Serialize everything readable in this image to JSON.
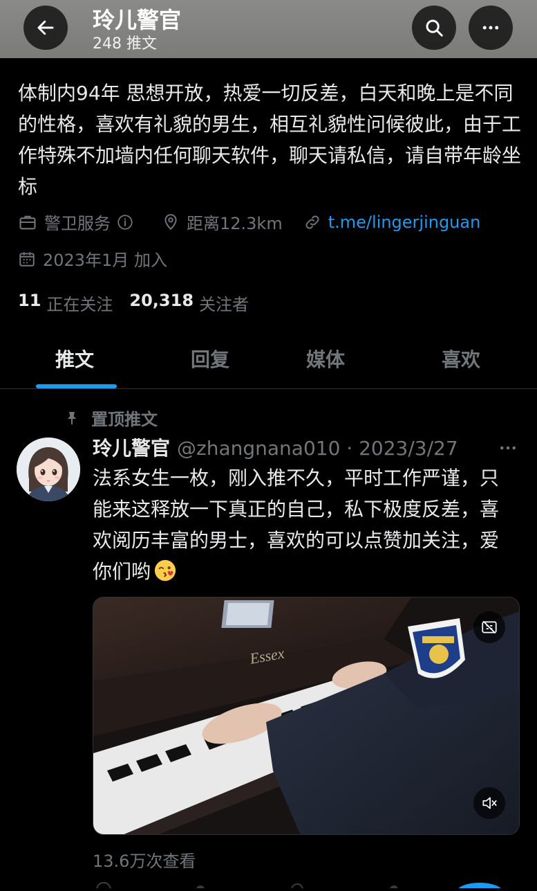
{
  "header": {
    "title": "玲儿警官",
    "subtitle": "248 推文",
    "back_icon": "arrow-left-icon",
    "search_icon": "search-icon",
    "more_icon": "more-horizontal-icon"
  },
  "profile": {
    "bio": "体制内94年 思想开放，热爱一切反差，白天和晚上是不同的性格，喜欢有礼貌的男生，相互礼貌性问候彼此，由于工作特殊不加墙内任何聊天软件，聊天请私信，请自带年龄坐标",
    "category": "警卫服务",
    "distance": "距离12.3km",
    "link": "t.me/lingerjinguan",
    "joined": "2023年1月 加入",
    "following_count": "11",
    "following_label": "正在关注",
    "followers_count": "20,318",
    "followers_label": "关注者"
  },
  "tabs": [
    {
      "label": "推文",
      "active": true
    },
    {
      "label": "回复",
      "active": false
    },
    {
      "label": "媒体",
      "active": false
    },
    {
      "label": "喜欢",
      "active": false
    }
  ],
  "tweet": {
    "pinned_label": "置顶推文",
    "name": "玲儿警官",
    "handle_date": "@zhangnana010 · 2023/3/27",
    "text": "法系女生一枚，刚入推不久，平时工作严谨，只能来这释放一下真正的自己，私下极度反差，喜欢阅历丰富的男士，喜欢的可以点赞加关注，爱你们哟",
    "emoji": "kissing-face-emoji",
    "video_brand": "Essex",
    "views": "13.6万次查看"
  },
  "colors": {
    "background": "#000000",
    "text": "#e7e9ea",
    "secondary": "#71767b",
    "accent": "#1d9bf0"
  }
}
